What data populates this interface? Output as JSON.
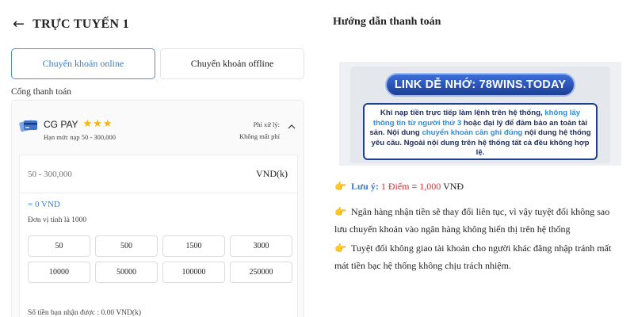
{
  "header": {
    "back_icon": "arrow-left-icon",
    "title": "TRỰC TUYẾN 1"
  },
  "tabs": [
    {
      "label": "Chuyển khoản online",
      "active": true
    },
    {
      "label": "Chuyển khoản offline",
      "active": false
    }
  ],
  "gateway": {
    "section_label": "Cổng thanh toán",
    "name": "CG PAY",
    "stars": "★★★",
    "limit": "Hạn mức nạp 50 - 300,000",
    "fee_label": "Phí xử lý:",
    "fee_value": "Không mất phí"
  },
  "deposit": {
    "amount_placeholder": "50 - 300,000",
    "currency": "VND(k)",
    "converted": "= 0 VND",
    "unit_note": "Đơn vị tính là 1000",
    "quick_amounts": [
      "50",
      "500",
      "1500",
      "3000",
      "10000",
      "50000",
      "100000",
      "250000"
    ],
    "received": "Số tiền bạn nhận được : 0.00 VND(k)"
  },
  "guide": {
    "title": "Hướng dẫn thanh toán",
    "banner_link": "LINK DỄ NHỚ: 78WINS.TODAY",
    "banner_text_1": "Khi nạp tiền trực tiếp làm lệnh trên hệ thống, ",
    "banner_hl_1": "không lấy thông tin từ người thứ 3",
    "banner_text_2": " hoặc đại lý để đảm bảo an toàn tài sản. Nội dung ",
    "banner_hl_2": "chuyển khoản cần ghi đúng",
    "banner_text_3": " nội dung hệ thống yêu cầu. Ngoài nội dung trên hệ thống tất cả đều không hợp lệ.",
    "note_label": "Lưu ý:",
    "note_value": "1 Điểm",
    "note_eq": " = ",
    "note_value2": "1,000",
    "note_unit": " VNĐ",
    "note2": "Ngân hàng nhận tiền sẽ thay đổi liên tục, vì vậy tuyệt đối không sao lưu chuyển khoản vào ngân hàng không hiển thị trên hệ thống",
    "note3": "Tuyệt đối không giao tài khoản cho người khác đăng nhập tránh mất mát tiền bạc hệ thống không chịu trách nhiệm."
  },
  "colors": {
    "accent": "#3a7bc8",
    "star": "#f5b50a",
    "red": "#d32f2f",
    "banner_blue": "#1f3f8f"
  }
}
